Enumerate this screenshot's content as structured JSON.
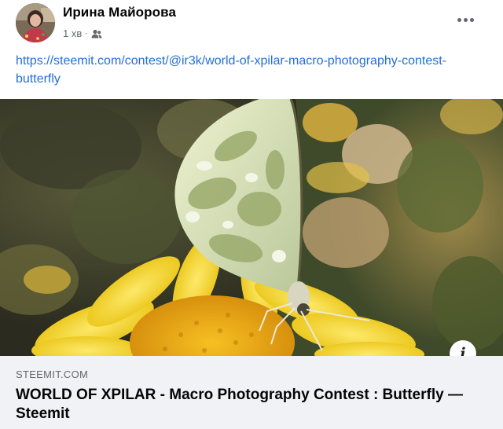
{
  "post": {
    "author_name": "Ирина Майорова",
    "timestamp": "1 хв",
    "separator": "·",
    "audience_icon": "friends-icon",
    "more_icon": "more-horizontal-icon",
    "text_link": "https://steemit.com/contest/@ir3k/world-of-xpilar-macro-photography-contest-butterfly"
  },
  "link_preview": {
    "image_subject": "white butterfly on yellow flower",
    "info_icon": "info-icon",
    "info_label": "i",
    "domain": "STEEMIT.COM",
    "title": "WORLD OF XPILAR - Macro Photography Contest : Butterfly — Steemit"
  },
  "colors": {
    "link": "#216fdb",
    "secondary_text": "#65676b",
    "preview_background": "#f0f2f5"
  }
}
